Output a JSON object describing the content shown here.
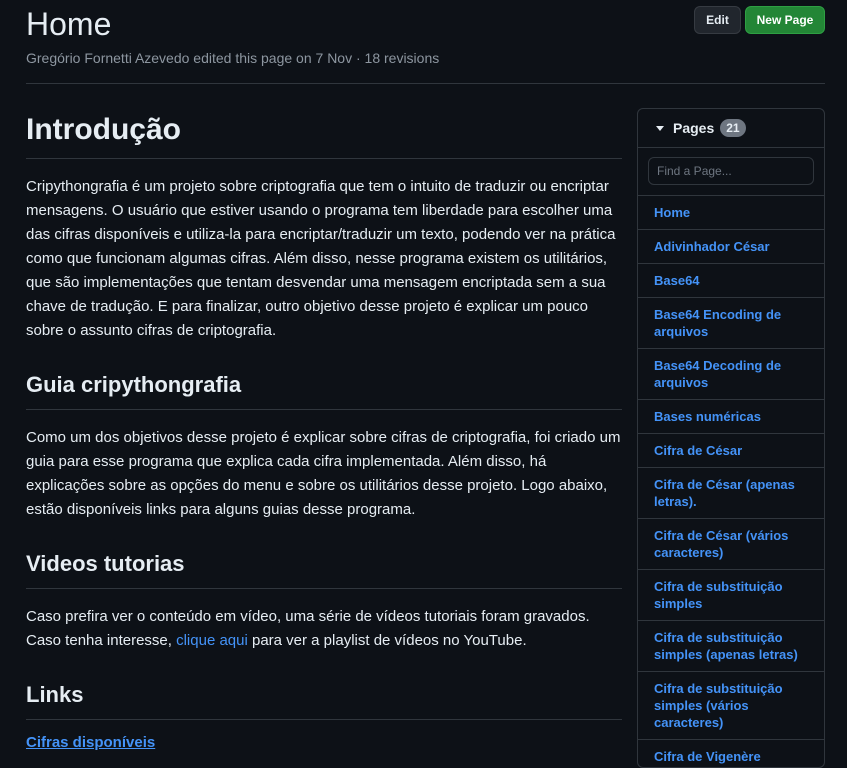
{
  "header": {
    "title": "Home",
    "meta": "Gregório Fornetti Azevedo edited this page on 7 Nov · 18 revisions",
    "edit_label": "Edit",
    "new_page_label": "New Page"
  },
  "article": {
    "h_intro": "Introdução",
    "p_intro": "Cripythongrafia é um projeto sobre criptografia que tem o intuito de traduzir ou encriptar mensagens. O usuário que estiver usando o programa tem liberdade para escolher uma das cifras disponíveis e utiliza-la para encriptar/traduzir um texto, podendo ver na prática como que funcionam algumas cifras. Além disso, nesse programa existem os utilitários, que são implementações que tentam desvendar uma mensagem encriptada sem a sua chave de tradução. E para finalizar, outro objetivo desse projeto é explicar um pouco sobre o assunto cifras de criptografia.",
    "h_guia": "Guia cripythongrafia",
    "p_guia": "Como um dos objetivos desse projeto é explicar sobre cifras de criptografia, foi criado um guia para esse programa que explica cada cifra implementada. Além disso, há explicações sobre as opções do menu e sobre os utilitários desse projeto. Logo abaixo, estão disponíveis links para alguns guias desse programa.",
    "h_videos": "Videos tutorias",
    "p_videos_before": "Caso prefira ver o conteúdo em vídeo, uma série de vídeos tutoriais foram gravados. Caso tenha interesse, ",
    "p_videos_link": "clique aqui",
    "p_videos_after": " para ver a playlist de vídeos no YouTube.",
    "h_links": "Links",
    "link_cifras": "Cifras disponíveis"
  },
  "sidebar": {
    "title": "Pages",
    "count": "21",
    "search_placeholder": "Find a Page...",
    "items": [
      "Home",
      "Adivinhador César",
      "Base64",
      "Base64 Encoding de arquivos",
      "Base64 Decoding de arquivos",
      "Bases numéricas",
      "Cifra de César",
      "Cifra de César (apenas letras).",
      "Cifra de César (vários caracteres)",
      "Cifra de substituição simples",
      "Cifra de substituição simples (apenas letras)",
      "Cifra de substituição simples (vários caracteres)",
      "Cifra de Vigenère"
    ]
  }
}
